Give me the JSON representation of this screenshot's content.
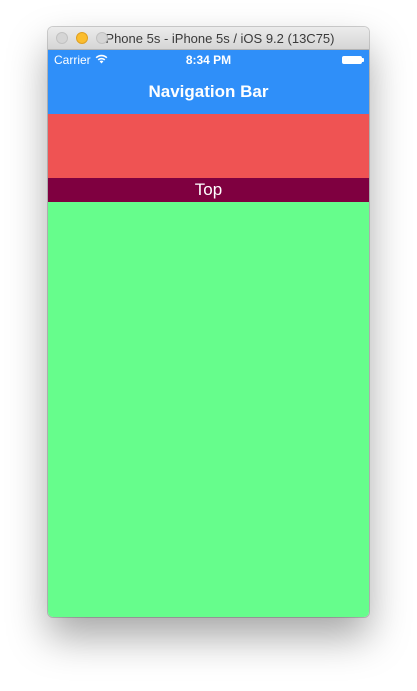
{
  "window": {
    "title": "iPhone 5s - iPhone 5s / iOS 9.2 (13C75)"
  },
  "status_bar": {
    "carrier": "Carrier",
    "time": "8:34 PM",
    "wifi_icon": "wifi-icon",
    "battery_icon": "battery-icon"
  },
  "navigation_bar": {
    "title": "Navigation Bar"
  },
  "content": {
    "top_label": "Top"
  },
  "colors": {
    "nav_blue": "#2f8ff9",
    "red_view": "#ef5353",
    "top_label_bg": "#7f0040",
    "green_view": "#66fd8c"
  }
}
